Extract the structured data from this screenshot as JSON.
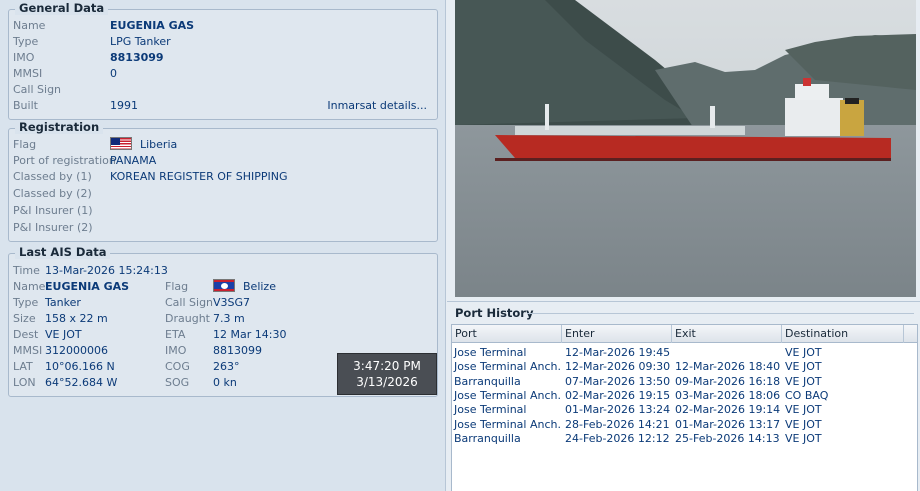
{
  "general": {
    "title": "General Data",
    "name_label": "Name",
    "name": "EUGENIA GAS",
    "type_label": "Type",
    "type": "LPG Tanker",
    "imo_label": "IMO",
    "imo": "8813099",
    "mmsi_label": "MMSI",
    "mmsi": "0",
    "callsign_label": "Call Sign",
    "callsign": "",
    "built_label": "Built",
    "built": "1991",
    "inmarsat_link": "Inmarsat details..."
  },
  "registration": {
    "title": "Registration",
    "flag_label": "Flag",
    "flag": "Liberia",
    "port_label": "Port of registration",
    "port": "PANAMA",
    "classed1_label": "Classed by (1)",
    "classed1": "KOREAN REGISTER OF SHIPPING",
    "classed2_label": "Classed by (2)",
    "classed2": "",
    "pi1_label": "P&I Insurer (1)",
    "pi1": "",
    "pi2_label": "P&I Insurer (2)",
    "pi2": ""
  },
  "ais": {
    "title": "Last AIS Data",
    "time_label": "Time",
    "time": "13-Mar-2026 15:24:13",
    "name_label": "Name",
    "name": "EUGENIA GAS",
    "type_label": "Type",
    "type": "Tanker",
    "size_label": "Size",
    "size": "158 x 22 m",
    "dest_label": "Dest",
    "dest": "VE JOT",
    "mmsi_label": "MMSI",
    "mmsi": "312000006",
    "lat_label": "LAT",
    "lat": "10°06.166 N",
    "lon_label": "LON",
    "lon": "64°52.684 W",
    "flag_label": "Flag",
    "flag": "Belize",
    "callsign_label": "Call Sign",
    "callsign": "V3SG7",
    "draught_label": "Draught",
    "draught": "7.3 m",
    "eta_label": "ETA",
    "eta": "12 Mar 14:30",
    "imo_label": "IMO",
    "imo": "8813099",
    "cog_label": "COG",
    "cog": "263°",
    "sog_label": "SOG",
    "sog": "0 kn"
  },
  "clock": {
    "time": "3:47:20 PM",
    "date": "3/13/2026"
  },
  "port_history": {
    "title": "Port History",
    "columns": [
      "Port",
      "Enter",
      "Exit",
      "Destination"
    ],
    "rows": [
      [
        "Jose Terminal",
        "12-Mar-2026 19:45",
        "",
        "VE JOT"
      ],
      [
        "Jose Terminal Anch.",
        "12-Mar-2026 09:30",
        "12-Mar-2026 18:40",
        "VE JOT"
      ],
      [
        "Barranquilla",
        "07-Mar-2026 13:50",
        "09-Mar-2026 16:18",
        "VE JOT"
      ],
      [
        "Jose Terminal Anch.",
        "02-Mar-2026 19:15",
        "03-Mar-2026 18:06",
        "CO BAQ"
      ],
      [
        "Jose Terminal",
        "01-Mar-2026 13:24",
        "02-Mar-2026 19:14",
        "VE JOT"
      ],
      [
        "Jose Terminal Anch.",
        "28-Feb-2026 14:21",
        "01-Mar-2026 13:17",
        "VE JOT"
      ],
      [
        "Barranquilla",
        "24-Feb-2026 12:12",
        "25-Feb-2026 14:13",
        "VE JOT"
      ]
    ]
  }
}
